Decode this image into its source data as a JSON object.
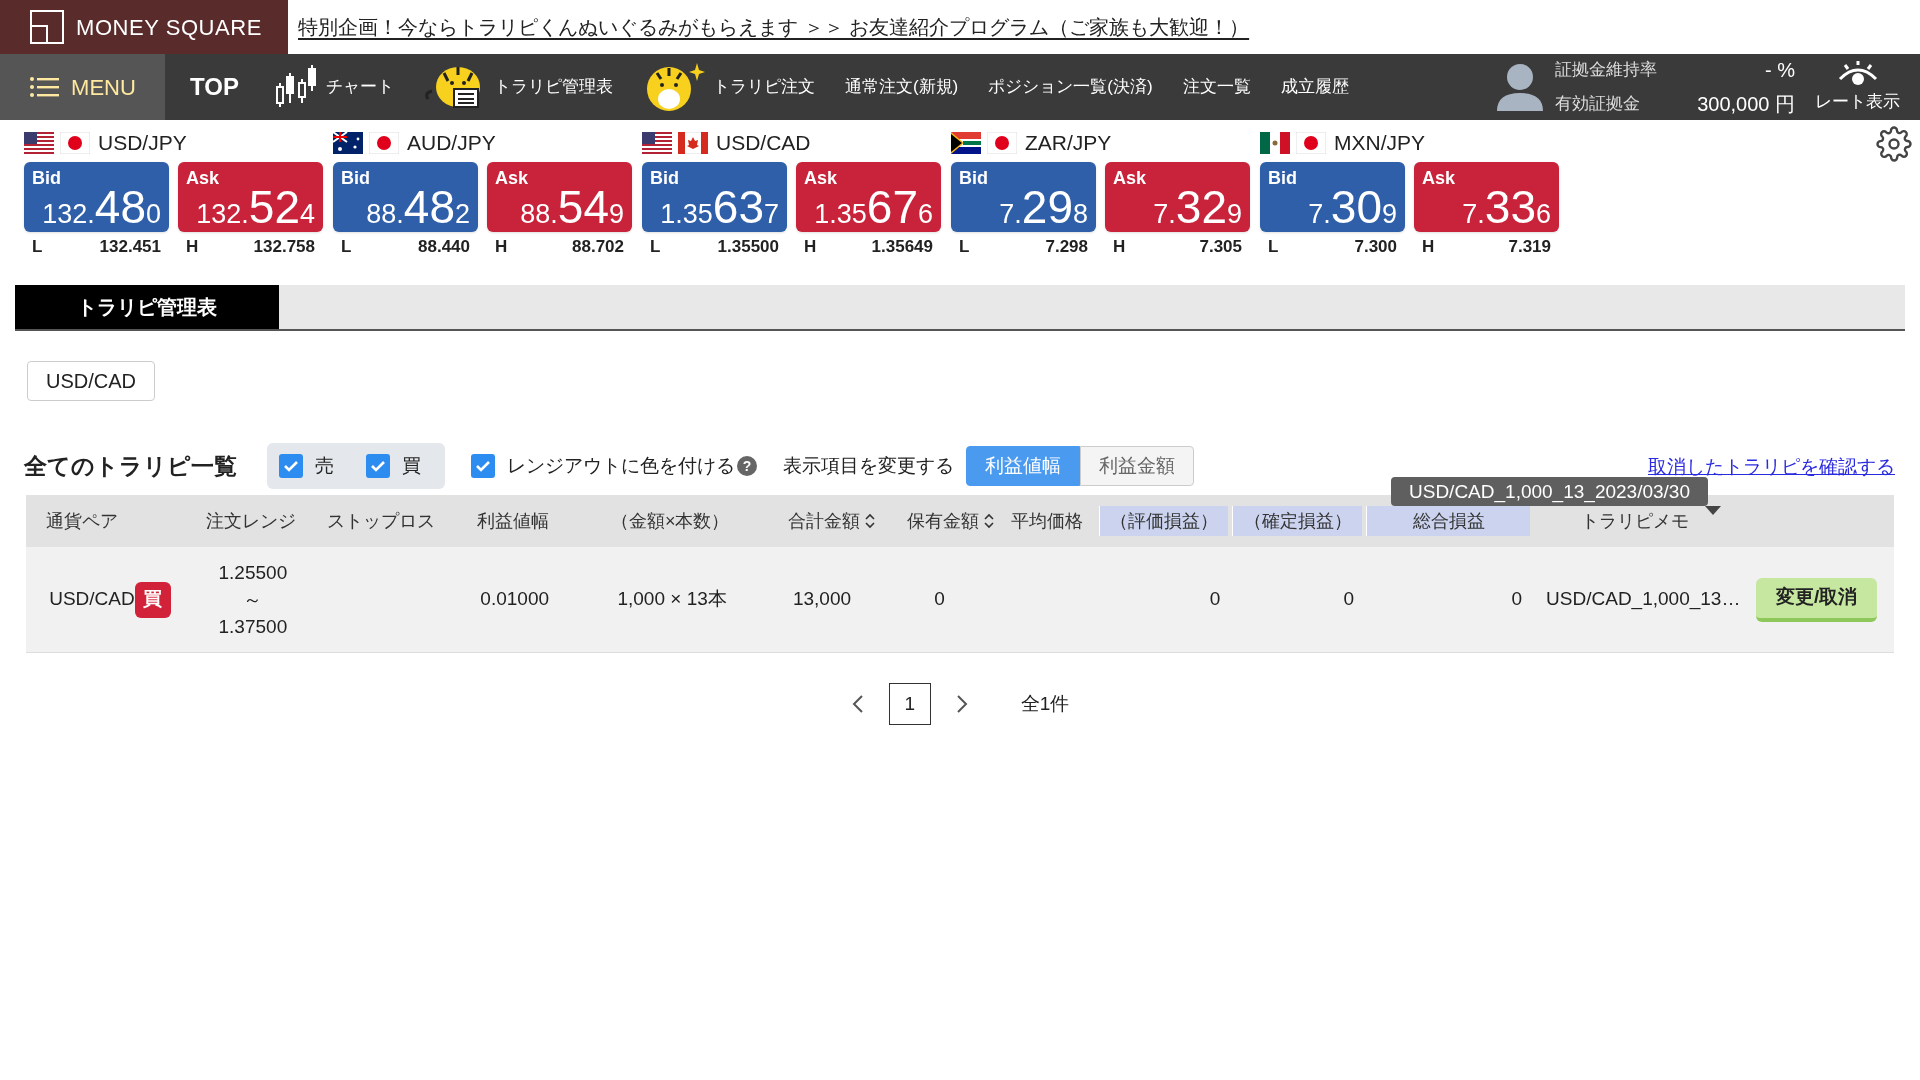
{
  "header": {
    "logo": "MONEY SQUARE",
    "banner": "特別企画！今ならトラリピくんぬいぐるみがもらえます ＞＞ お友達紹介プログラム（ご家族も大歓迎！）"
  },
  "nav": {
    "menu": "MENU",
    "items": [
      {
        "label": "TOP"
      },
      {
        "label": "チャート"
      },
      {
        "label": "トラリピ管理表"
      },
      {
        "label": "トラリピ注文"
      },
      {
        "label": "通常注文(新規)"
      },
      {
        "label": "ポジション一覧(決済)"
      },
      {
        "label": "注文一覧"
      },
      {
        "label": "成立履歴"
      }
    ],
    "account": [
      {
        "label": "証拠金維持率",
        "value": "- %"
      },
      {
        "label": "有効証拠金",
        "value": "300,000 円"
      }
    ],
    "rate_toggle": "レート表示"
  },
  "rates": [
    {
      "pair": "USD/JPY",
      "quotes": [
        {
          "label": "Bid",
          "head": "132.",
          "big": "48",
          "tail": "0"
        },
        {
          "label": "Ask",
          "head": "132.",
          "big": "52",
          "tail": "4"
        }
      ],
      "stats": [
        {
          "label": "L",
          "value": "132.451"
        },
        {
          "label": "H",
          "value": "132.758"
        }
      ]
    },
    {
      "pair": "AUD/JPY",
      "quotes": [
        {
          "label": "Bid",
          "head": "88.",
          "big": "48",
          "tail": "2"
        },
        {
          "label": "Ask",
          "head": "88.",
          "big": "54",
          "tail": "9"
        }
      ],
      "stats": [
        {
          "label": "L",
          "value": "88.440"
        },
        {
          "label": "H",
          "value": "88.702"
        }
      ]
    },
    {
      "pair": "USD/CAD",
      "quotes": [
        {
          "label": "Bid",
          "head": "1.35",
          "big": "63",
          "tail": "7"
        },
        {
          "label": "Ask",
          "head": "1.35",
          "big": "67",
          "tail": "6"
        }
      ],
      "stats": [
        {
          "label": "L",
          "value": "1.35500"
        },
        {
          "label": "H",
          "value": "1.35649"
        }
      ]
    },
    {
      "pair": "ZAR/JPY",
      "quotes": [
        {
          "label": "Bid",
          "head": "7.",
          "big": "29",
          "tail": "8"
        },
        {
          "label": "Ask",
          "head": "7.",
          "big": "32",
          "tail": "9"
        }
      ],
      "stats": [
        {
          "label": "L",
          "value": "7.298"
        },
        {
          "label": "H",
          "value": "7.305"
        }
      ]
    },
    {
      "pair": "MXN/JPY",
      "quotes": [
        {
          "label": "Bid",
          "head": "7.",
          "big": "30",
          "tail": "9"
        },
        {
          "label": "Ask",
          "head": "7.",
          "big": "33",
          "tail": "6"
        }
      ],
      "stats": [
        {
          "label": "L",
          "value": "7.300"
        },
        {
          "label": "H",
          "value": "7.319"
        }
      ]
    }
  ],
  "page_tabs": [
    {
      "label": "トラリピ管理表",
      "selected": true
    }
  ],
  "pair_button": "USD/CAD",
  "list": {
    "title": "全てのトラリピ一覧",
    "filters": [
      {
        "label": "売",
        "checked": true
      },
      {
        "label": "買",
        "checked": true
      }
    ],
    "range_color": {
      "label": "レンジアウトに色を付ける",
      "checked": true,
      "help": "?"
    },
    "display_label": "表示項目を変更する",
    "display_tabs": [
      {
        "label": "利益値幅",
        "selected": true
      },
      {
        "label": "利益金額",
        "selected": false
      }
    ],
    "cancelled_link": "取消したトラリピを確認する"
  },
  "table": {
    "columns": [
      {
        "label": "通貨ペア"
      },
      {
        "label": "注文レンジ"
      },
      {
        "label": "ストップロス"
      },
      {
        "label": "利益値幅"
      },
      {
        "label": "（金額×本数）"
      },
      {
        "label": "合計金額",
        "sortable": true
      },
      {
        "label": "保有金額",
        "sortable": true
      },
      {
        "label": "平均価格"
      },
      {
        "label": "（評価損益）",
        "highlight": true
      },
      {
        "label": "（確定損益）",
        "highlight": true
      },
      {
        "label": "総合損益",
        "highlight": true
      },
      {
        "label": "トラリピメモ"
      }
    ],
    "rows": [
      {
        "cells": [
          {
            "kind": "pair",
            "text": "USD/CAD",
            "badge": "買"
          },
          {
            "kind": "range",
            "lines": [
              "1.25500",
              "～",
              "1.37500"
            ]
          },
          {
            "kind": "empty"
          },
          {
            "kind": "text",
            "text": "0.01000"
          },
          {
            "kind": "amount",
            "text": "1,000",
            "sep": "×",
            "count": "13本"
          },
          {
            "kind": "text",
            "text": "13,000"
          },
          {
            "kind": "text",
            "text": "0"
          },
          {
            "kind": "empty"
          },
          {
            "kind": "num",
            "text": "0"
          },
          {
            "kind": "num",
            "text": "0"
          },
          {
            "kind": "num",
            "text": "0"
          },
          {
            "kind": "memo",
            "text": "USD/CAD_1,000_13…"
          },
          {
            "kind": "button",
            "text": "変更/取消"
          }
        ]
      }
    ]
  },
  "tooltip": "USD/CAD_1,000_13_2023/03/30",
  "pagination": {
    "pages": [
      {
        "label": "1",
        "selected": true
      }
    ],
    "total": "全1件"
  }
}
